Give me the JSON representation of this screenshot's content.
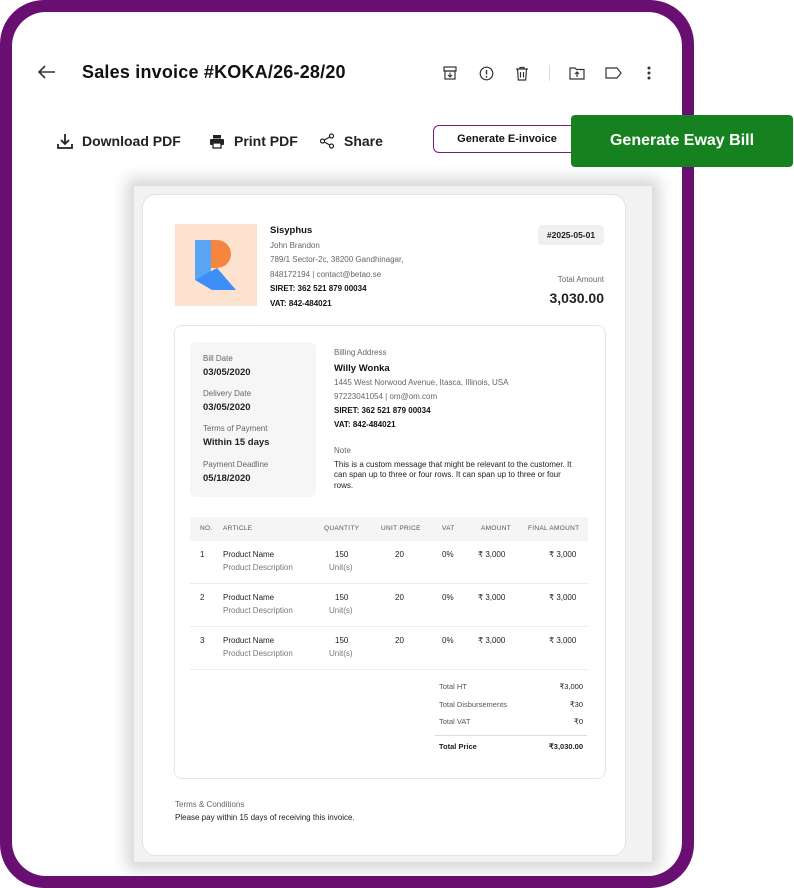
{
  "header": {
    "title": "Sales invoice #KOKA/26-28/20",
    "icons": [
      "back-arrow-icon",
      "archive-icon",
      "alert-icon",
      "trash-icon",
      "folder-upload-icon",
      "tag-icon",
      "more-vertical-icon"
    ]
  },
  "actions": {
    "download": "Download PDF",
    "print": "Print PDF",
    "share": "Share",
    "einvoice": "Generate E-invoice",
    "eway": "Generate Eway Bill"
  },
  "invoice": {
    "company": {
      "name": "Sisyphus",
      "contact": "John Brandon",
      "address": "789/1 Sector-2c, 38200 Gandhinagar,",
      "phone_email": "848172194 | contact@betao.se",
      "siret": "SIRET: 362 521 879 00034",
      "vat": "VAT: 842-484021"
    },
    "number": "#2025-05-01",
    "total_label": "Total Amount",
    "total_value": "3,030.00",
    "dates": {
      "bill_label": "Bill Date",
      "bill": "03/05/2020",
      "delivery_label": "Delivery Date",
      "delivery": "03/05/2020",
      "terms_label": "Terms of Payment",
      "terms": "Within 15 days",
      "deadline_label": "Payment Deadline",
      "deadline": "05/18/2020"
    },
    "billing": {
      "label": "Billing Address",
      "name": "Willy Wonka",
      "address": "1445 West Norwood Avenue, Itasca, Illinois, USA",
      "phone_email": "97223041054 | om@om.com",
      "siret": "SIRET: 362 521 879 00034",
      "vat": "VAT: 842-484021",
      "note_label": "Note",
      "note_1": "This is a custom message that might be relevant to the customer. It",
      "note_2": "can span up to three or four rows. It can span up to three or four",
      "note_3": "rows."
    },
    "table": {
      "headers": [
        "NO.",
        "ARTICLE",
        "QUANTITY",
        "UNIT PRICE",
        "VAT",
        "AMOUNT",
        "FINAL AMOUNT"
      ],
      "rows": [
        {
          "no": "1",
          "article": "Product Name",
          "desc": "Product Description",
          "qty": "150",
          "unit": "Unit(s)",
          "price": "20",
          "vat": "0%",
          "amount": "₹ 3,000",
          "final": "₹ 3,000"
        },
        {
          "no": "2",
          "article": "Product Name",
          "desc": "Product Description",
          "qty": "150",
          "unit": "Unit(s)",
          "price": "20",
          "vat": "0%",
          "amount": "₹ 3,000",
          "final": "₹ 3,000"
        },
        {
          "no": "3",
          "article": "Product Name",
          "desc": "Product Description",
          "qty": "150",
          "unit": "Unit(s)",
          "price": "20",
          "vat": "0%",
          "amount": "₹ 3,000",
          "final": "₹ 3,000"
        }
      ]
    },
    "summary": {
      "ht_label": "Total HT",
      "ht": "₹3,000",
      "disb_label": "Total Disbursements",
      "disb": "₹30",
      "vat_label": "Total VAT",
      "vat": "₹0",
      "price_label": "Total Price",
      "price": "₹3,030.00"
    },
    "terms": {
      "label": "Terms & Conditions",
      "text": "Please pay within 15 days of receiving this invoice."
    }
  },
  "colors": {
    "frame": "#6a0f72",
    "eway": "#16821f",
    "logo_bg": "#fde3cf",
    "logo_orange": "#f5853f",
    "logo_blue": "#3d8ef7"
  }
}
